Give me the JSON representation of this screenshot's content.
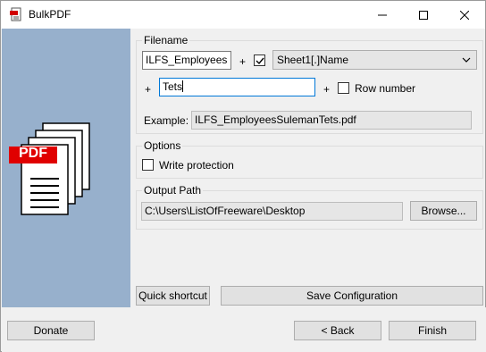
{
  "window": {
    "title": "BulkPDF",
    "icon": "pdf-app-icon"
  },
  "left_pane": {
    "art_text": "PDF",
    "bg_color": "#97b0cc"
  },
  "filename_group": {
    "label": "Filename",
    "prefix_value": "ILFS_Employees",
    "plus_1": "+",
    "field_checkbox_checked": true,
    "field_select_value": "Sheet1[.]Name",
    "plus_2": "+",
    "suffix_value": "Tets",
    "plus_3": "+",
    "row_number_checked": false,
    "row_number_label": "Row number",
    "example_label": "Example:",
    "example_value": "ILFS_EmployeesSulemanTets.pdf"
  },
  "options_group": {
    "label": "Options",
    "write_protection_checked": false,
    "write_protection_label": "Write protection"
  },
  "output_group": {
    "label": "Output Path",
    "path_value": "C:\\Users\\ListOfFreeware\\Desktop",
    "browse_label": "Browse..."
  },
  "actions": {
    "quick_shortcut_label": "Quick shortcut",
    "save_config_label": "Save Configuration"
  },
  "footer": {
    "donate_label": "Donate",
    "back_label": "< Back",
    "finish_label": "Finish"
  }
}
